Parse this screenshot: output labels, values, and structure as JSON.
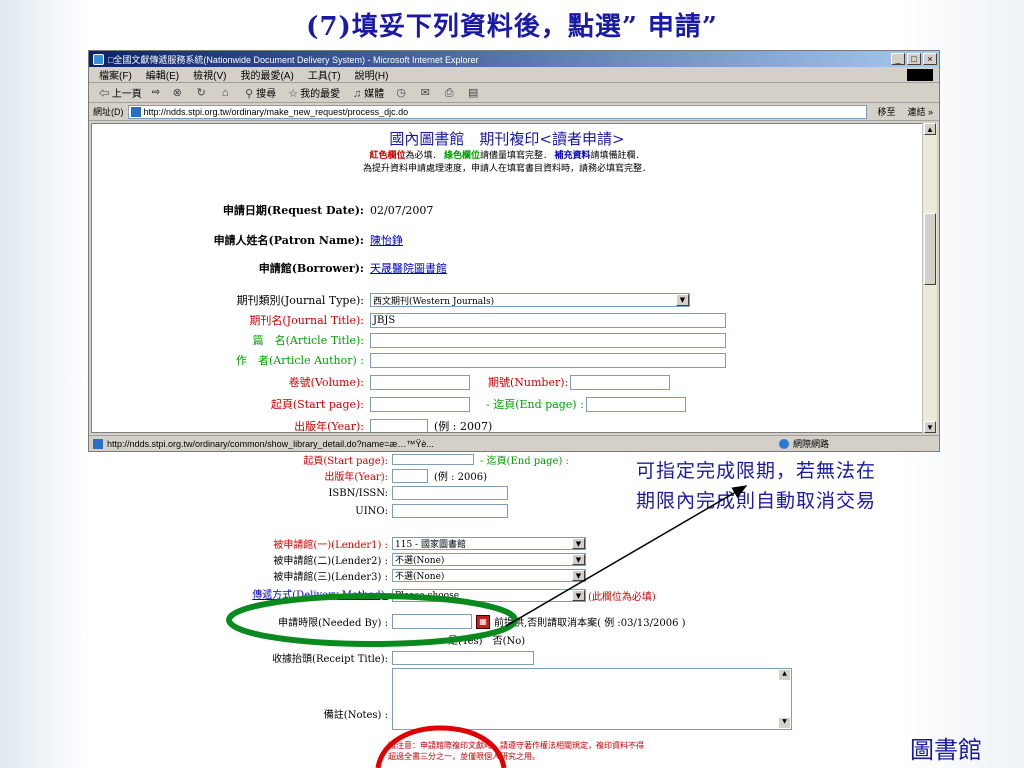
{
  "slide": {
    "title": "(7)填妥下列資料後，點選” 申請”",
    "annotation_line1": "可指定完成限期，若無法在",
    "annotation_line2": "期限內完成則自動取消交易",
    "footer_library": "圖書館"
  },
  "window": {
    "title": "□全國文獻傳遞服務系統(Nationwide Document Delivery System) - Microsoft Internet Explorer",
    "min": "_",
    "max": "□",
    "close": "×",
    "menu": [
      "檔案(F)",
      "編輯(E)",
      "檢視(V)",
      "我的最愛(A)",
      "工具(T)",
      "說明(H)"
    ],
    "toolbar": {
      "back": "⇦ 上一頁",
      "forward": "⇨",
      "search": "搜尋",
      "favorites": "我的最愛",
      "media": "媒體"
    },
    "address_label": "網址(D)",
    "address_url": "http://ndds.stpi.org.tw/ordinary/make_new_request/process_djc.do",
    "go_label": "移至",
    "links_label": "連結 »",
    "status_url": "http://ndds.stpi.org.tw/ordinary/common/show_library_detail.do?name=æ…™Ÿè...",
    "status_zone": "網際網路"
  },
  "form": {
    "heading": "國內圖書館　期刊複印<讀者申請>",
    "note1_red": "紅色欄位",
    "note1_a": "為必填．",
    "note1_green": "綠色欄位",
    "note1_b": "請儘量填寫完整．",
    "note1_blue": "補充資料",
    "note1_c": "請填備註欄．",
    "note2": "為提升資料申請處理速度，申請人在填寫書目資料時，請務必填寫完整．",
    "request_date_label": "申請日期(Request Date):",
    "request_date": "02/07/2007",
    "patron_label": "申請人姓名(Patron Name):",
    "patron": "陳怡錚",
    "borrower_label": "申請館(Borrower):",
    "borrower": "天晟醫院圖書館",
    "journal_type_label": "期刊類別(Journal Type):",
    "journal_type": "西文期刊(Western Journals)",
    "journal_title_label": "期刊名(Journal Title):",
    "journal_title": "JBJS",
    "article_title_label": "篇　名(Article Title):",
    "article_author_label": "作　者(Article Author) :",
    "volume_label": "卷號(Volume):",
    "number_label": "期號(Number):",
    "start_page_label": "起頁(Start page):",
    "end_page_label": "- 迄頁(End page) :",
    "year_label": "出版年(Year):",
    "year_example": "(例 : 2007)"
  },
  "form2": {
    "start_page_label": "起頁(Start page):",
    "end_page_label": "- 迄頁(End page) :",
    "year_label": "出版年(Year):",
    "year_example": "(例 : 2006)",
    "isbn_label": "ISBN/ISSN:",
    "uino_label": "UINO:",
    "lender1_label": "被申請館(一)(Lender1) :",
    "lender1": "115 - 國家圖書館",
    "lender2_label": "被申請館(二)(Lender2) :",
    "lender2": "不選(None)",
    "lender3_label": "被申請館(三)(Lender3) :",
    "lender3": "不選(None)",
    "delivery_label": "傳遞方式(Delivery Method):",
    "delivery": "Please choose",
    "delivery_required": "(此欄位為必填)",
    "needed_by_label": "申請時限(Needed By) :",
    "needed_by_note": "前提供,否則請取消本案( 例 :03/13/2006 )",
    "yes_no": "是(Yes)　否(No)",
    "receipt_label": "收據抬頭(Receipt Title):",
    "notes_label": "備註(Notes) :",
    "warning1": "請注意：申請館際複印文獻時，請遵守著作權法相關規定，複印資料不得",
    "warning2": "超過全書三分之一，並僅限個人研究之用。"
  },
  "colors": {
    "title_blue": "#1a1aa8",
    "ellipse_green": "#0a8a1e",
    "ellipse_red": "#e00000"
  }
}
